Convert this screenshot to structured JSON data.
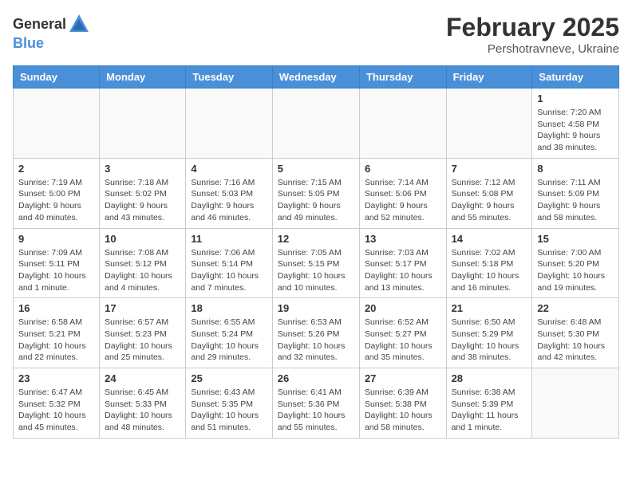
{
  "app": {
    "name_general": "General",
    "name_blue": "Blue"
  },
  "title": {
    "month_year": "February 2025",
    "location": "Pershotravneve, Ukraine"
  },
  "weekdays": [
    "Sunday",
    "Monday",
    "Tuesday",
    "Wednesday",
    "Thursday",
    "Friday",
    "Saturday"
  ],
  "weeks": [
    [
      {
        "day": "",
        "info": ""
      },
      {
        "day": "",
        "info": ""
      },
      {
        "day": "",
        "info": ""
      },
      {
        "day": "",
        "info": ""
      },
      {
        "day": "",
        "info": ""
      },
      {
        "day": "",
        "info": ""
      },
      {
        "day": "1",
        "info": "Sunrise: 7:20 AM\nSunset: 4:58 PM\nDaylight: 9 hours and 38 minutes."
      }
    ],
    [
      {
        "day": "2",
        "info": "Sunrise: 7:19 AM\nSunset: 5:00 PM\nDaylight: 9 hours and 40 minutes."
      },
      {
        "day": "3",
        "info": "Sunrise: 7:18 AM\nSunset: 5:02 PM\nDaylight: 9 hours and 43 minutes."
      },
      {
        "day": "4",
        "info": "Sunrise: 7:16 AM\nSunset: 5:03 PM\nDaylight: 9 hours and 46 minutes."
      },
      {
        "day": "5",
        "info": "Sunrise: 7:15 AM\nSunset: 5:05 PM\nDaylight: 9 hours and 49 minutes."
      },
      {
        "day": "6",
        "info": "Sunrise: 7:14 AM\nSunset: 5:06 PM\nDaylight: 9 hours and 52 minutes."
      },
      {
        "day": "7",
        "info": "Sunrise: 7:12 AM\nSunset: 5:08 PM\nDaylight: 9 hours and 55 minutes."
      },
      {
        "day": "8",
        "info": "Sunrise: 7:11 AM\nSunset: 5:09 PM\nDaylight: 9 hours and 58 minutes."
      }
    ],
    [
      {
        "day": "9",
        "info": "Sunrise: 7:09 AM\nSunset: 5:11 PM\nDaylight: 10 hours and 1 minute."
      },
      {
        "day": "10",
        "info": "Sunrise: 7:08 AM\nSunset: 5:12 PM\nDaylight: 10 hours and 4 minutes."
      },
      {
        "day": "11",
        "info": "Sunrise: 7:06 AM\nSunset: 5:14 PM\nDaylight: 10 hours and 7 minutes."
      },
      {
        "day": "12",
        "info": "Sunrise: 7:05 AM\nSunset: 5:15 PM\nDaylight: 10 hours and 10 minutes."
      },
      {
        "day": "13",
        "info": "Sunrise: 7:03 AM\nSunset: 5:17 PM\nDaylight: 10 hours and 13 minutes."
      },
      {
        "day": "14",
        "info": "Sunrise: 7:02 AM\nSunset: 5:18 PM\nDaylight: 10 hours and 16 minutes."
      },
      {
        "day": "15",
        "info": "Sunrise: 7:00 AM\nSunset: 5:20 PM\nDaylight: 10 hours and 19 minutes."
      }
    ],
    [
      {
        "day": "16",
        "info": "Sunrise: 6:58 AM\nSunset: 5:21 PM\nDaylight: 10 hours and 22 minutes."
      },
      {
        "day": "17",
        "info": "Sunrise: 6:57 AM\nSunset: 5:23 PM\nDaylight: 10 hours and 25 minutes."
      },
      {
        "day": "18",
        "info": "Sunrise: 6:55 AM\nSunset: 5:24 PM\nDaylight: 10 hours and 29 minutes."
      },
      {
        "day": "19",
        "info": "Sunrise: 6:53 AM\nSunset: 5:26 PM\nDaylight: 10 hours and 32 minutes."
      },
      {
        "day": "20",
        "info": "Sunrise: 6:52 AM\nSunset: 5:27 PM\nDaylight: 10 hours and 35 minutes."
      },
      {
        "day": "21",
        "info": "Sunrise: 6:50 AM\nSunset: 5:29 PM\nDaylight: 10 hours and 38 minutes."
      },
      {
        "day": "22",
        "info": "Sunrise: 6:48 AM\nSunset: 5:30 PM\nDaylight: 10 hours and 42 minutes."
      }
    ],
    [
      {
        "day": "23",
        "info": "Sunrise: 6:47 AM\nSunset: 5:32 PM\nDaylight: 10 hours and 45 minutes."
      },
      {
        "day": "24",
        "info": "Sunrise: 6:45 AM\nSunset: 5:33 PM\nDaylight: 10 hours and 48 minutes."
      },
      {
        "day": "25",
        "info": "Sunrise: 6:43 AM\nSunset: 5:35 PM\nDaylight: 10 hours and 51 minutes."
      },
      {
        "day": "26",
        "info": "Sunrise: 6:41 AM\nSunset: 5:36 PM\nDaylight: 10 hours and 55 minutes."
      },
      {
        "day": "27",
        "info": "Sunrise: 6:39 AM\nSunset: 5:38 PM\nDaylight: 10 hours and 58 minutes."
      },
      {
        "day": "28",
        "info": "Sunrise: 6:38 AM\nSunset: 5:39 PM\nDaylight: 11 hours and 1 minute."
      },
      {
        "day": "",
        "info": ""
      }
    ]
  ]
}
